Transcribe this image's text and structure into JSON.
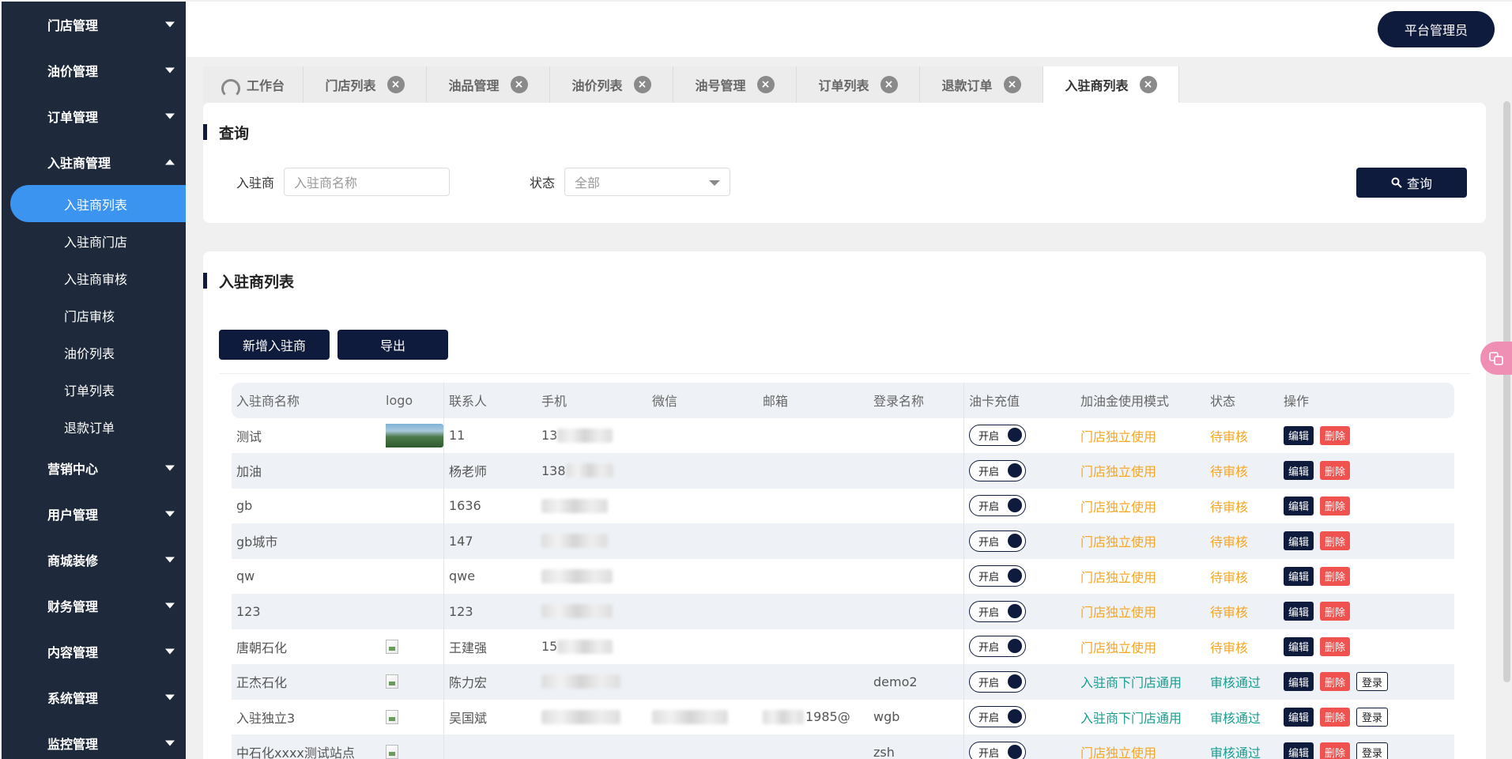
{
  "sidebar": {
    "groups": [
      {
        "label": "门店管理"
      },
      {
        "label": "油价管理"
      },
      {
        "label": "订单管理"
      },
      {
        "label": "入驻商管理"
      },
      {
        "label": "营销中心"
      },
      {
        "label": "用户管理"
      },
      {
        "label": "商城装修"
      },
      {
        "label": "财务管理"
      },
      {
        "label": "内容管理"
      },
      {
        "label": "系统管理"
      },
      {
        "label": "监控管理"
      }
    ],
    "subitems": [
      {
        "label": "入驻商列表",
        "active": true
      },
      {
        "label": "入驻商门店"
      },
      {
        "label": "入驻商审核"
      },
      {
        "label": "门店审核"
      },
      {
        "label": "油价列表"
      },
      {
        "label": "订单列表"
      },
      {
        "label": "退款订单"
      }
    ]
  },
  "header": {
    "admin_label": "平台管理员"
  },
  "tabs": [
    {
      "label": "工作台"
    },
    {
      "label": "门店列表"
    },
    {
      "label": "油品管理"
    },
    {
      "label": "油价列表"
    },
    {
      "label": "油号管理"
    },
    {
      "label": "订单列表"
    },
    {
      "label": "退款订单"
    },
    {
      "label": "入驻商列表",
      "active": true
    }
  ],
  "query": {
    "title": "查询",
    "merchant_label": "入驻商",
    "merchant_placeholder": "入驻商名称",
    "status_label": "状态",
    "status_value": "全部",
    "button_label": "查询"
  },
  "list": {
    "title": "入驻商列表",
    "add_button": "新增入驻商",
    "export_button": "导出",
    "columns": [
      "入驻商名称",
      "logo",
      "联系人",
      "手机",
      "微信",
      "邮箱",
      "登录名称",
      "油卡充值",
      "加油金使用模式",
      "状态",
      "操作"
    ],
    "toggle_label": "开启",
    "edit_label": "编辑",
    "delete_label": "删除",
    "login_label": "登录",
    "rows": [
      {
        "name": "测试",
        "contact": "11",
        "phone": "13",
        "email": "",
        "login": "",
        "mode": "门店独立使用",
        "status": "待审核"
      },
      {
        "name": "加油",
        "contact": "杨老师",
        "phone": "138",
        "email": "",
        "login": "",
        "mode": "门店独立使用",
        "status": "待审核"
      },
      {
        "name": "gb",
        "contact": "1636",
        "phone": "",
        "email": "",
        "login": "",
        "mode": "门店独立使用",
        "status": "待审核"
      },
      {
        "name": "gb城市",
        "contact": "147",
        "phone": "",
        "email": "",
        "login": "",
        "mode": "门店独立使用",
        "status": "待审核"
      },
      {
        "name": "qw",
        "contact": "qwe",
        "phone": "",
        "email": "",
        "login": "",
        "mode": "门店独立使用",
        "status": "待审核"
      },
      {
        "name": "123",
        "contact": "123",
        "phone": "",
        "email": "",
        "login": "",
        "mode": "门店独立使用",
        "status": "待审核"
      },
      {
        "name": "唐朝石化",
        "contact": "王建强",
        "phone": "15",
        "email": "",
        "login": "",
        "mode": "门店独立使用",
        "status": "待审核"
      },
      {
        "name": "正杰石化",
        "contact": "陈力宏",
        "phone": "",
        "email": "",
        "login": "demo2",
        "mode": "入驻商下门店通用",
        "status": "审核通过"
      },
      {
        "name": "入驻独立3",
        "contact": "吴国斌",
        "phone": "",
        "email": "1985@",
        "login": "wgb",
        "mode": "入驻商下门店通用",
        "status": "审核通过"
      },
      {
        "name": "中石化xxxx测试站点",
        "contact": "",
        "phone": "",
        "email": "",
        "login": "zsh",
        "mode": "门店独立使用",
        "status": "审核通过"
      }
    ]
  },
  "colors": {
    "sidebar": "#1e2a3c",
    "accent": "#3a94f0",
    "primary": "#0f1b3c",
    "pending": "#f5a623",
    "approved": "#1a9c8e",
    "danger": "#f0524f"
  }
}
